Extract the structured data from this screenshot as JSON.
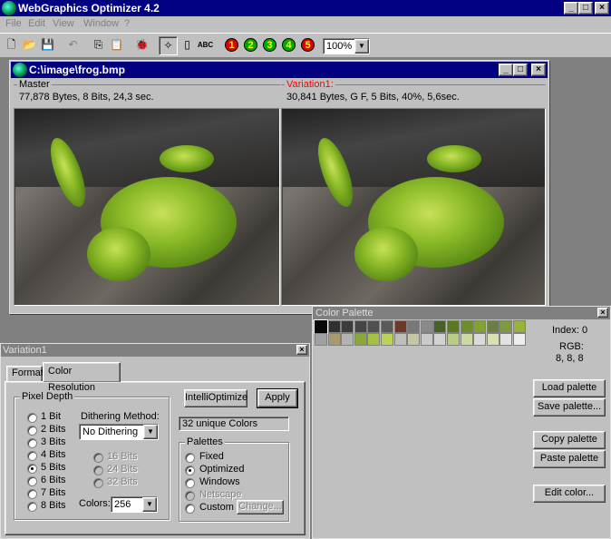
{
  "app": {
    "title": "WebGraphics Optimizer 4.2",
    "menu": [
      "File",
      "Edit",
      "View",
      "Window",
      "?"
    ]
  },
  "toolbar": {
    "zoom": "100%",
    "abc_label": "ABC",
    "variation_buttons": [
      "1",
      "2",
      "3",
      "4",
      "5"
    ]
  },
  "image_window": {
    "title": "C:\\image\\frog.bmp",
    "master": {
      "label": "Master",
      "info": "77,878 Bytes, 8 Bits, 24,3 sec."
    },
    "variation": {
      "label": "Variation1:",
      "info": "30,841 Bytes, G F, 5 Bits, 40%, 5,6sec.",
      "label_color": "#ff0000"
    }
  },
  "variation_panel": {
    "title": "Variation1",
    "tabs": [
      "Format",
      "Color Resolution"
    ],
    "active_tab": "Color Resolution",
    "pixel_depth": {
      "title": "Pixel Depth",
      "options": [
        "1 Bit",
        "2 Bits",
        "3 Bits",
        "4 Bits",
        "5 Bits",
        "6 Bits",
        "7 Bits",
        "8 Bits"
      ],
      "selected": "5 Bits"
    },
    "dithering": {
      "label": "Dithering Method:",
      "value": "No Dithering"
    },
    "bits_options": [
      "16 Bits",
      "24 Bits",
      "32 Bits"
    ],
    "colors": {
      "label": "Colors:",
      "value": "256"
    },
    "intellioptimize_label": "IntelliOptimize",
    "apply_label": "Apply",
    "unique_colors": "32 unique Colors",
    "palettes": {
      "title": "Palettes",
      "options": [
        "Fixed",
        "Optimized",
        "Windows",
        "Netscape",
        "Custom"
      ],
      "selected": "Optimized",
      "change_label": "Change..."
    }
  },
  "color_palette": {
    "title": "Color Palette",
    "index_label": "Index: 0",
    "rgb_label": "RGB:",
    "rgb_value": "8, 8, 8",
    "swatches_row1": [
      "#080808",
      "#303030",
      "#3c3c3c",
      "#464646",
      "#505050",
      "#5a5a5a",
      "#6c3a2a",
      "#787878",
      "#8a8a8a",
      "#48612a",
      "#5a7a22",
      "#6e8e2a",
      "#82a232",
      "#6a7e46",
      "#7e9a3e",
      "#96b43a"
    ],
    "swatches_row2": [
      "#a0a0a0",
      "#a69a6e",
      "#b4b4b4",
      "#8aa83a",
      "#a6c044",
      "#bad25a",
      "#bebebe",
      "#c6c6a6",
      "#cacaca",
      "#d2d2d2",
      "#b8cc82",
      "#cadaa2",
      "#dadada",
      "#d6e2b2",
      "#e2e2e2",
      "#eeeeee"
    ],
    "buttons": [
      "Load palette",
      "Save palette...",
      "Copy palette",
      "Paste palette",
      "Edit color..."
    ]
  }
}
